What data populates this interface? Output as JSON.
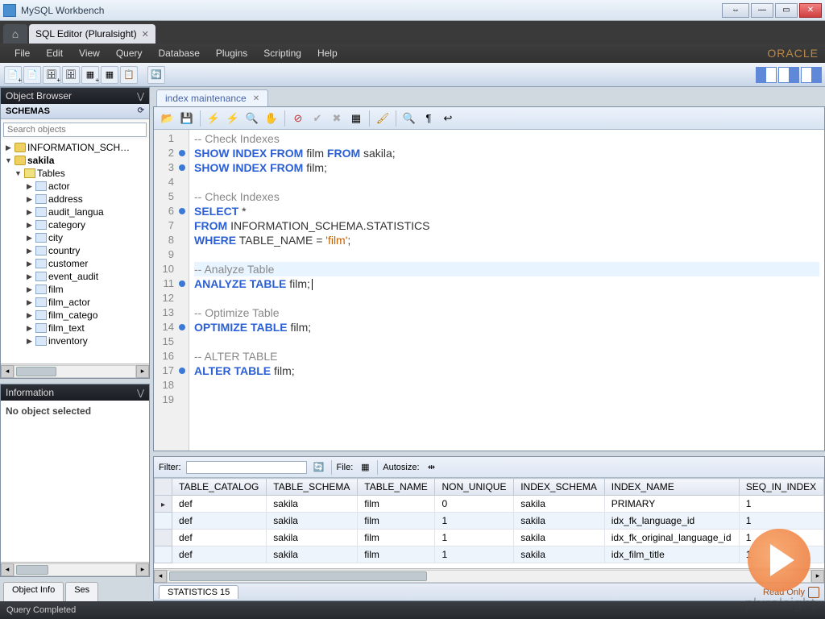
{
  "window": {
    "title": "MySQL Workbench"
  },
  "app_tabs": {
    "active": "SQL Editor (Pluralsight)"
  },
  "menu": [
    "File",
    "Edit",
    "View",
    "Query",
    "Database",
    "Plugins",
    "Scripting",
    "Help"
  ],
  "brand": "ORACLE",
  "sidebar": {
    "object_browser": "Object Browser",
    "schemas_label": "SCHEMAS",
    "search_placeholder": "Search objects",
    "tree": {
      "info_schema": "INFORMATION_SCH…",
      "sakila": "sakila",
      "tables_label": "Tables",
      "tables": [
        "actor",
        "address",
        "audit_langua",
        "category",
        "city",
        "country",
        "customer",
        "event_audit",
        "film",
        "film_actor",
        "film_catego",
        "film_text",
        "inventory"
      ]
    },
    "information": "Information",
    "no_object": "No object selected",
    "bottom_tabs": [
      "Object Info",
      "Ses"
    ]
  },
  "editor": {
    "tab": "index maintenance",
    "lines": [
      {
        "n": 1,
        "dot": false,
        "seg": [
          {
            "t": "-- Check Indexes",
            "c": "cm"
          }
        ]
      },
      {
        "n": 2,
        "dot": true,
        "seg": [
          {
            "t": "SHOW INDEX FROM",
            "c": "kw"
          },
          {
            "t": " film ",
            "c": ""
          },
          {
            "t": "FROM",
            "c": "kw"
          },
          {
            "t": " sakila;",
            "c": ""
          }
        ]
      },
      {
        "n": 3,
        "dot": true,
        "seg": [
          {
            "t": "SHOW INDEX FROM",
            "c": "kw"
          },
          {
            "t": " film;",
            "c": ""
          }
        ]
      },
      {
        "n": 4,
        "dot": false,
        "seg": []
      },
      {
        "n": 5,
        "dot": false,
        "seg": [
          {
            "t": "-- Check Indexes",
            "c": "cm"
          }
        ]
      },
      {
        "n": 6,
        "dot": true,
        "seg": [
          {
            "t": "SELECT",
            "c": "kw"
          },
          {
            "t": " *",
            "c": ""
          }
        ]
      },
      {
        "n": 7,
        "dot": false,
        "seg": [
          {
            "t": "FROM",
            "c": "kw"
          },
          {
            "t": " INFORMATION_SCHEMA.STATISTICS",
            "c": ""
          }
        ]
      },
      {
        "n": 8,
        "dot": false,
        "seg": [
          {
            "t": "WHERE",
            "c": "kw"
          },
          {
            "t": " TABLE_NAME = ",
            "c": ""
          },
          {
            "t": "'film'",
            "c": "str"
          },
          {
            "t": ";",
            "c": ""
          }
        ]
      },
      {
        "n": 9,
        "dot": false,
        "seg": []
      },
      {
        "n": 10,
        "dot": false,
        "hl": true,
        "seg": [
          {
            "t": "-- Analyze Table",
            "c": "cm"
          }
        ]
      },
      {
        "n": 11,
        "dot": true,
        "seg": [
          {
            "t": "ANALYZE TABLE",
            "c": "kw"
          },
          {
            "t": " film;",
            "c": ""
          }
        ],
        "cursor": true
      },
      {
        "n": 12,
        "dot": false,
        "seg": []
      },
      {
        "n": 13,
        "dot": false,
        "seg": [
          {
            "t": "-- Optimize Table",
            "c": "cm"
          }
        ]
      },
      {
        "n": 14,
        "dot": true,
        "seg": [
          {
            "t": "OPTIMIZE TABLE",
            "c": "kw"
          },
          {
            "t": " film;",
            "c": ""
          }
        ]
      },
      {
        "n": 15,
        "dot": false,
        "seg": []
      },
      {
        "n": 16,
        "dot": false,
        "seg": [
          {
            "t": "-- ALTER TABLE",
            "c": "cm"
          }
        ]
      },
      {
        "n": 17,
        "dot": true,
        "seg": [
          {
            "t": "ALTER TABLE",
            "c": "kw"
          },
          {
            "t": " film;",
            "c": ""
          }
        ]
      },
      {
        "n": 18,
        "dot": false,
        "seg": []
      },
      {
        "n": 19,
        "dot": false,
        "seg": []
      }
    ]
  },
  "results": {
    "filter_label": "Filter:",
    "file_label": "File:",
    "autosize_label": "Autosize:",
    "columns": [
      "TABLE_CATALOG",
      "TABLE_SCHEMA",
      "TABLE_NAME",
      "NON_UNIQUE",
      "INDEX_SCHEMA",
      "INDEX_NAME",
      "SEQ_IN_INDEX"
    ],
    "rows": [
      [
        "def",
        "sakila",
        "film",
        "0",
        "sakila",
        "PRIMARY",
        "1"
      ],
      [
        "def",
        "sakila",
        "film",
        "1",
        "sakila",
        "idx_fk_language_id",
        "1"
      ],
      [
        "def",
        "sakila",
        "film",
        "1",
        "sakila",
        "idx_fk_original_language_id",
        "1"
      ],
      [
        "def",
        "sakila",
        "film",
        "1",
        "sakila",
        "idx_film_title",
        "1"
      ]
    ],
    "tab": "STATISTICS 15",
    "readonly": "Read Only"
  },
  "status": "Query Completed",
  "watermark": "pluralsight"
}
